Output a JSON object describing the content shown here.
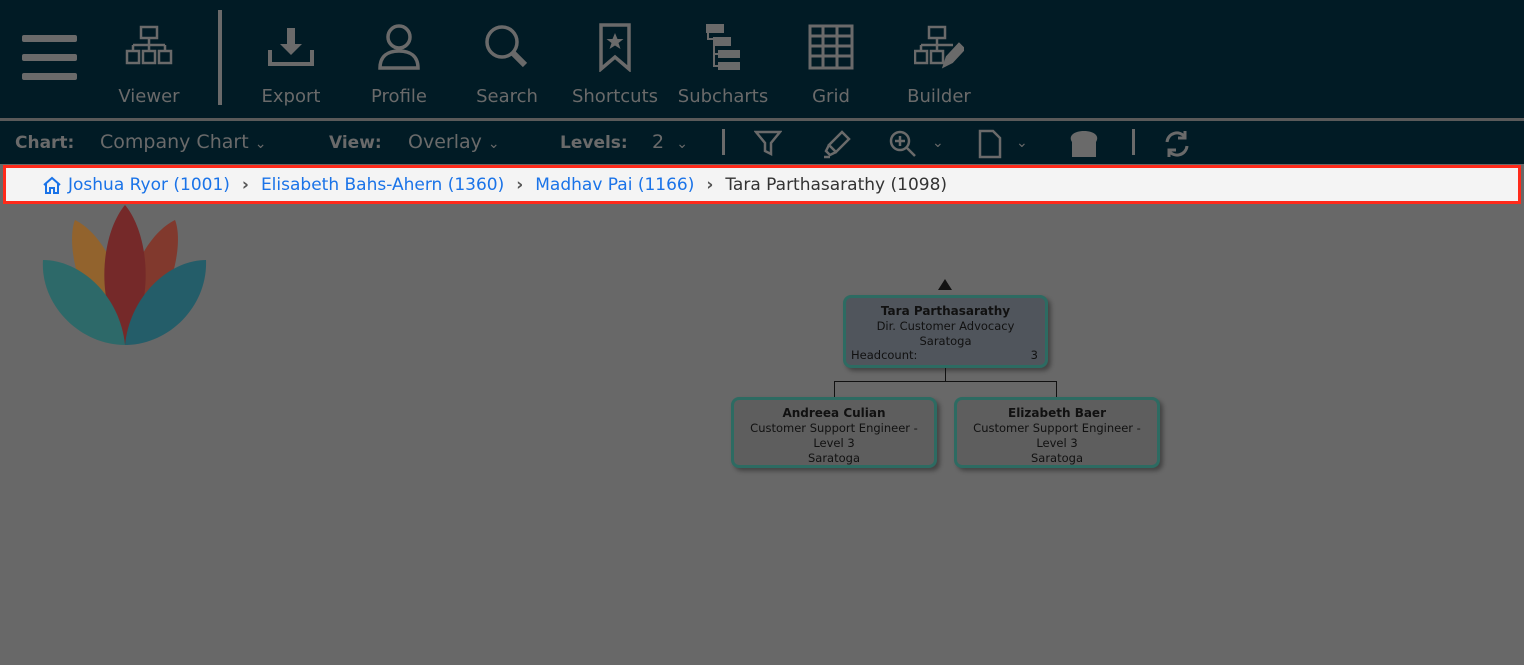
{
  "toolbar": {
    "items": [
      {
        "label": "Viewer",
        "icon": "org-chart-icon"
      },
      {
        "label": "Export",
        "icon": "download-icon"
      },
      {
        "label": "Profile",
        "icon": "user-icon"
      },
      {
        "label": "Search",
        "icon": "search-icon"
      },
      {
        "label": "Shortcuts",
        "icon": "bookmark-star-icon"
      },
      {
        "label": "Subcharts",
        "icon": "subcharts-icon"
      },
      {
        "label": "Grid",
        "icon": "grid-icon"
      },
      {
        "label": "Builder",
        "icon": "builder-icon"
      }
    ]
  },
  "options": {
    "chart_label": "Chart:",
    "chart_value": "Company Chart",
    "view_label": "View:",
    "view_value": "Overlay",
    "levels_label": "Levels:",
    "levels_value": "2"
  },
  "breadcrumb": [
    {
      "label": "Joshua Ryor (1001)"
    },
    {
      "label": "Elisabeth Bahs-Ahern (1360)"
    },
    {
      "label": "Madhav Pai (1166)"
    },
    {
      "label": "Tara Parthasarathy (1098)"
    }
  ],
  "chart": {
    "root": {
      "name": "Tara Parthasarathy",
      "title": "Dir. Customer Advocacy",
      "location": "Saratoga",
      "headcount_label": "Headcount:",
      "headcount": "3"
    },
    "children": [
      {
        "name": "Andreea Culian",
        "title": "Customer Support Engineer - Level 3",
        "location": "Saratoga"
      },
      {
        "name": "Elizabeth Baer",
        "title": "Customer Support Engineer - Level 3",
        "location": "Saratoga"
      }
    ]
  },
  "colors": {
    "topbar": "#011b25",
    "overlay": "#686868",
    "link": "#1a73e8",
    "highlight": "#ff2a1a",
    "card_border": "#2d6b62"
  }
}
